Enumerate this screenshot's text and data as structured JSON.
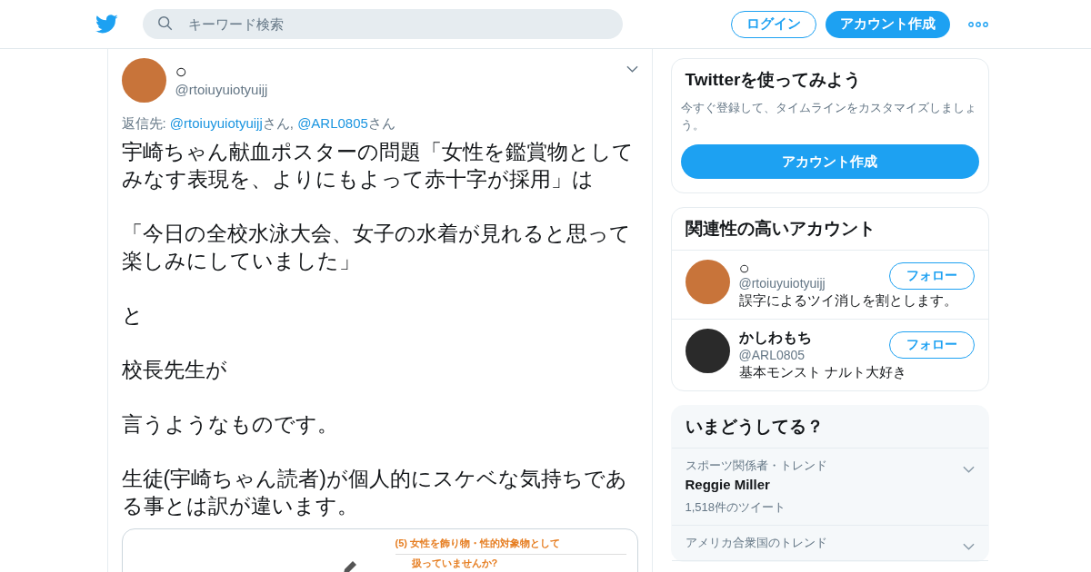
{
  "header": {
    "search": {
      "placeholder": "キーワード検索"
    },
    "login": "ログイン",
    "signup": "アカウント作成"
  },
  "tweet": {
    "name": "○",
    "handle": "@rtoiuyuiotyuijj",
    "reply_label": "返信先: ",
    "reply_to": [
      {
        "handle": "@rtoiuyuiotyuijj",
        "suffix": "さん, "
      },
      {
        "handle": "@ARL0805",
        "suffix": "さん"
      }
    ],
    "paragraphs": [
      "宇崎ちゃん献血ポスターの問題「女性を鑑賞物としてみなす表現を、よりにもよって赤十字が採用」は",
      "「今日の全校水泳大会、女子の水着が見れると思って楽しみにしていました」",
      "と",
      "校長先生が",
      "言うようなものです。",
      "生徒(宇崎ちゃん読者)が個人的にスケベな気持ちである事とは訳が違います。"
    ],
    "attachment": {
      "lines": [
        "(5) 女性を飾り物・性的対象物として",
        "扱っていませんか?"
      ]
    }
  },
  "signup_card": {
    "title": "Twitterを使ってみよう",
    "text": "今すぐ登録して、タイムラインをカスタマイズしましょう。",
    "button": "アカウント作成"
  },
  "related": {
    "title": "関連性の高いアカウント",
    "accounts": [
      {
        "name": "○",
        "handle": "@rtoiuyuiotyuijj",
        "bio": "誤字によるツイ消しを割とします。",
        "button": "フォロー",
        "color": "#c8743a"
      },
      {
        "name": "かしわもち",
        "handle": "@ARL0805",
        "bio": "基本モンスト ナルト大好き",
        "button": "フォロー",
        "color": "#2a2a2a"
      }
    ]
  },
  "trends": {
    "title": "いまどうしてる？",
    "items": [
      {
        "context": "スポーツ関係者・トレンド",
        "name": "Reggie Miller",
        "count": "1,518件のツイート"
      },
      {
        "context": "アメリカ合衆国のトレンド"
      }
    ]
  }
}
